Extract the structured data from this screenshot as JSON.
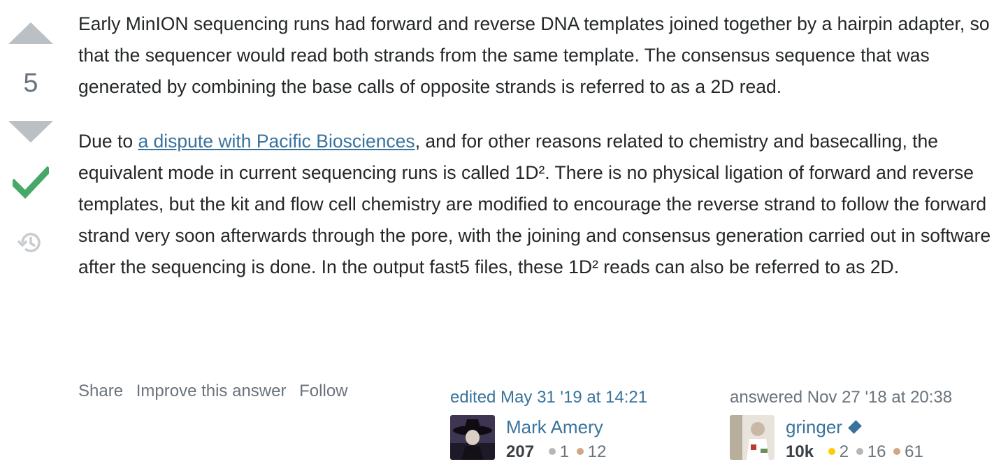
{
  "vote": {
    "count": "5"
  },
  "post": {
    "p1": "Early MinION sequencing runs had forward and reverse DNA templates joined together by a hairpin adapter, so that the sequencer would read both strands from the same template. The consensus sequence that was generated by combining the base calls of opposite strands is referred to as a 2D read.",
    "p2_before": "Due to ",
    "p2_link": "a dispute with Pacific Biosciences",
    "p2_after": ", and for other reasons related to chemistry and basecalling, the equivalent mode in current sequencing runs is called 1D². There is no physical ligation of forward and reverse templates, but the kit and flow cell chemistry are modified to encourage the reverse strand to follow the forward strand very soon afterwards through the pore, with the joining and consensus generation carried out in software after the sequencing is done. In the output fast5 files, these 1D² reads can also be referred to as 2D."
  },
  "menu": {
    "share": "Share",
    "improve": "Improve this answer",
    "follow": "Follow"
  },
  "edited": {
    "action": "edited May 31 '19 at 14:21",
    "user": "Mark Amery",
    "reputation": "207",
    "silver": "1",
    "bronze": "12"
  },
  "answered": {
    "action": "answered Nov 27 '18 at 20:38",
    "user": "gringer",
    "reputation": "10k",
    "gold": "2",
    "silver": "16",
    "bronze": "61"
  },
  "colors": {
    "accent": "#39739d",
    "accepted": "#48a868",
    "vote_arrow": "#bbc0c4"
  },
  "icons": {
    "upvote": "arrow-up-icon",
    "downvote": "arrow-down-icon",
    "accepted": "checkmark-icon",
    "history": "history-icon",
    "moderator": "diamond-icon"
  }
}
